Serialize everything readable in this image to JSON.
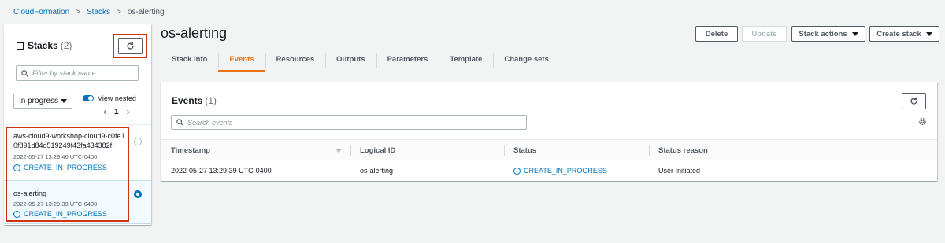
{
  "breadcrumb": {
    "item1": "CloudFormation",
    "item2": "Stacks",
    "current": "os-alerting"
  },
  "sidebar": {
    "title": "Stacks",
    "count": "(2)",
    "search_placeholder": "Filter by stack name",
    "filter_value": "In progress",
    "toggle_label": "View nested",
    "page": "1",
    "stacks": [
      {
        "name_line1": "aws-cloud9-workshop-cloud9-c0fe1",
        "name_line2": "0f891d84d519249f43fa434382f",
        "time": "2022-05-27 13:29:46 UTC-0400",
        "status": "CREATE_IN_PROGRESS",
        "selected": false
      },
      {
        "name_line1": "os-alerting",
        "name_line2": "",
        "time": "2022-05-27 13:29:39 UTC-0400",
        "status": "CREATE_IN_PROGRESS",
        "selected": true
      }
    ]
  },
  "header": {
    "title": "os-alerting",
    "delete": "Delete",
    "update": "Update",
    "stack_actions": "Stack actions",
    "create_stack": "Create stack"
  },
  "tabs": [
    "Stack info",
    "Events",
    "Resources",
    "Outputs",
    "Parameters",
    "Template",
    "Change sets"
  ],
  "events": {
    "title": "Events",
    "count": "(1)",
    "search_placeholder": "Search events",
    "columns": [
      "Timestamp",
      "Logical ID",
      "Status",
      "Status reason"
    ],
    "rows": [
      {
        "timestamp": "2022-05-27 13:29:39 UTC-0400",
        "logical_id": "os-alerting",
        "status": "CREATE_IN_PROGRESS",
        "reason": "User Initiated"
      }
    ]
  },
  "colors": {
    "link": "#0073bb",
    "active_tab": "#ec7211",
    "highlight": "#d13212"
  },
  "icons": [
    "refresh-icon",
    "search-icon",
    "info-icon",
    "gear-icon",
    "chevron-left-icon",
    "chevron-right-icon"
  ]
}
